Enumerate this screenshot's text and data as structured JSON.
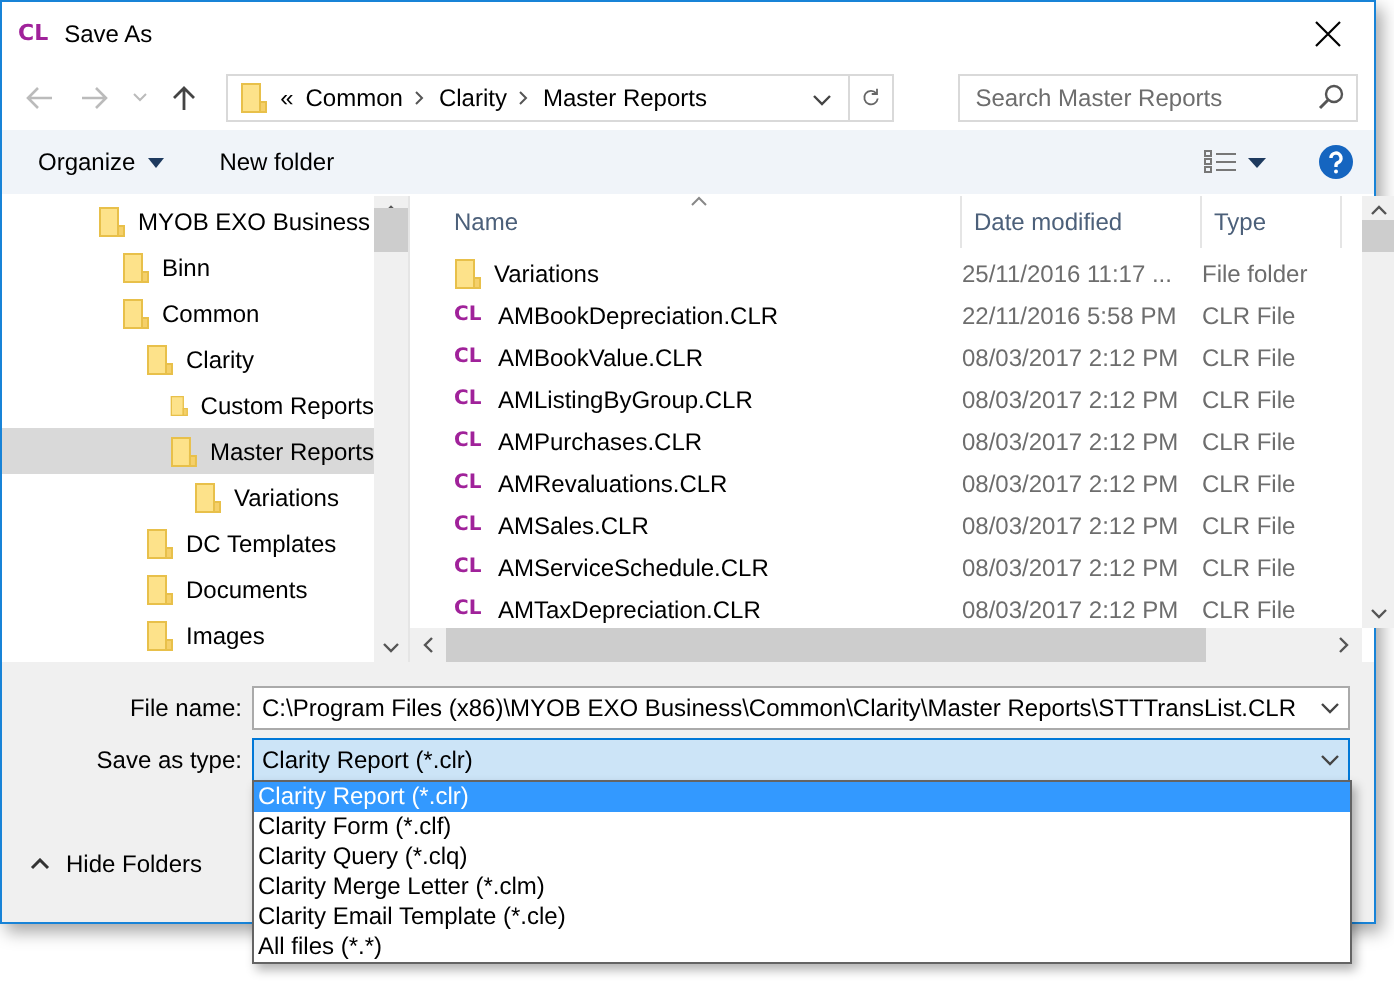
{
  "window": {
    "app_badge": "CL",
    "title": "Save As"
  },
  "address_bar": {
    "overflow": "«",
    "path": [
      "Common",
      "Clarity",
      "Master Reports"
    ]
  },
  "search": {
    "placeholder": "Search Master Reports"
  },
  "toolbar": {
    "organize": "Organize",
    "new_folder": "New folder"
  },
  "tree": [
    {
      "label": "MYOB EXO Business",
      "selected": false,
      "children": [
        {
          "label": "Binn",
          "selected": false
        },
        {
          "label": "Common",
          "selected": false,
          "children": [
            {
              "label": "Clarity",
              "selected": false,
              "children": [
                {
                  "label": "Custom Reports",
                  "selected": false
                },
                {
                  "label": "Master Reports",
                  "selected": true,
                  "children": [
                    {
                      "label": "Variations",
                      "selected": false
                    }
                  ]
                }
              ]
            },
            {
              "label": "DC Templates",
              "selected": false
            },
            {
              "label": "Documents",
              "selected": false
            },
            {
              "label": "Images",
              "selected": false
            }
          ]
        }
      ]
    }
  ],
  "columns": [
    "Name",
    "Date modified",
    "Type"
  ],
  "files": [
    {
      "kind": "folder",
      "name": "Variations",
      "date": "25/11/2016 11:17 ...",
      "type": "File folder"
    },
    {
      "kind": "clr",
      "badge": "CL",
      "name": "AMBookDepreciation.CLR",
      "date": "22/11/2016 5:58 PM",
      "type": "CLR File"
    },
    {
      "kind": "clr",
      "badge": "CL",
      "name": "AMBookValue.CLR",
      "date": "08/03/2017 2:12 PM",
      "type": "CLR File"
    },
    {
      "kind": "clr",
      "badge": "CL",
      "name": "AMListingByGroup.CLR",
      "date": "08/03/2017 2:12 PM",
      "type": "CLR File"
    },
    {
      "kind": "clr",
      "badge": "CL",
      "name": "AMPurchases.CLR",
      "date": "08/03/2017 2:12 PM",
      "type": "CLR File"
    },
    {
      "kind": "clr",
      "badge": "CL",
      "name": "AMRevaluations.CLR",
      "date": "08/03/2017 2:12 PM",
      "type": "CLR File"
    },
    {
      "kind": "clr",
      "badge": "CL",
      "name": "AMSales.CLR",
      "date": "08/03/2017 2:12 PM",
      "type": "CLR File"
    },
    {
      "kind": "clr",
      "badge": "CL",
      "name": "AMServiceSchedule.CLR",
      "date": "08/03/2017 2:12 PM",
      "type": "CLR File"
    },
    {
      "kind": "clr",
      "badge": "CL",
      "name": "AMTaxDepreciation.CLR",
      "date": "08/03/2017 2:12 PM",
      "type": "CLR File"
    }
  ],
  "file_name": {
    "label": "File name:",
    "value": "C:\\Program Files (x86)\\MYOB EXO Business\\Common\\Clarity\\Master Reports\\STTTransList.CLR"
  },
  "save_type": {
    "label": "Save as type:",
    "value": "Clarity Report (*.clr)",
    "expanded": true,
    "options": [
      {
        "label": "Clarity Report (*.clr)",
        "selected": true
      },
      {
        "label": "Clarity Form (*.clf)",
        "selected": false
      },
      {
        "label": "Clarity Query (*.clq)",
        "selected": false
      },
      {
        "label": "Clarity Merge Letter (*.clm)",
        "selected": false
      },
      {
        "label": "Clarity Email Template (*.cle)",
        "selected": false
      },
      {
        "label": "All files (*.*)",
        "selected": false
      }
    ]
  },
  "hide_folders": "Hide Folders"
}
